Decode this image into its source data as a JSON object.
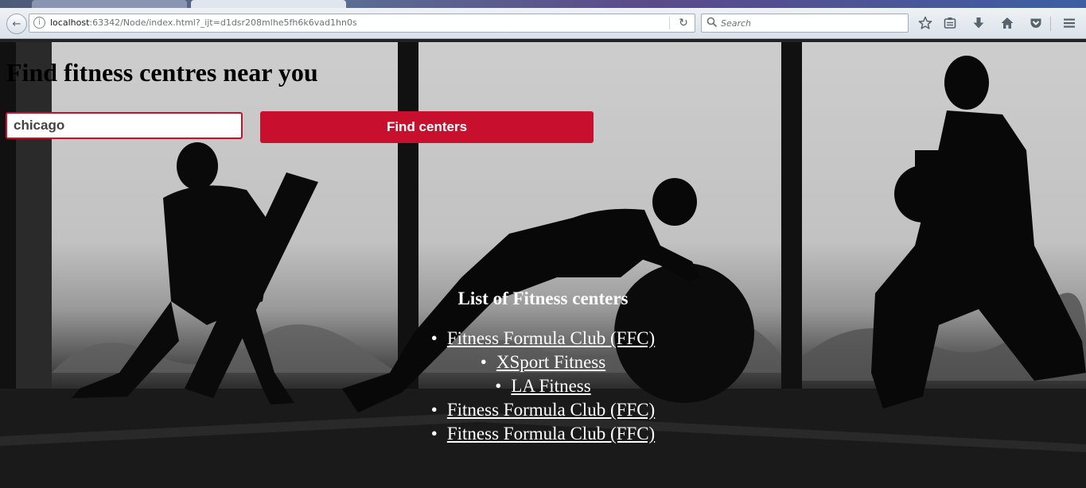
{
  "browser": {
    "url_host": "localhost",
    "url_rest": ":63342/Node/index.html?_ijt=d1dsr208mlhe5fh6k6vad1hn0s",
    "search_placeholder": "Search",
    "accent_tab": "#dfe6ee"
  },
  "page": {
    "title": "Find fitness centres near you",
    "search": {
      "value": "chicago"
    },
    "find_button": "Find centers",
    "list_heading": "List of Fitness centers",
    "centers": [
      "Fitness Formula Club (FFC)",
      "XSport Fitness",
      "LA Fitness",
      "Fitness Formula Club (FFC)",
      "Fitness Formula Club (FFC)"
    ],
    "colors": {
      "button": "#c8102e",
      "input_border": "#c8102e",
      "list_text": "#ffffff"
    }
  }
}
